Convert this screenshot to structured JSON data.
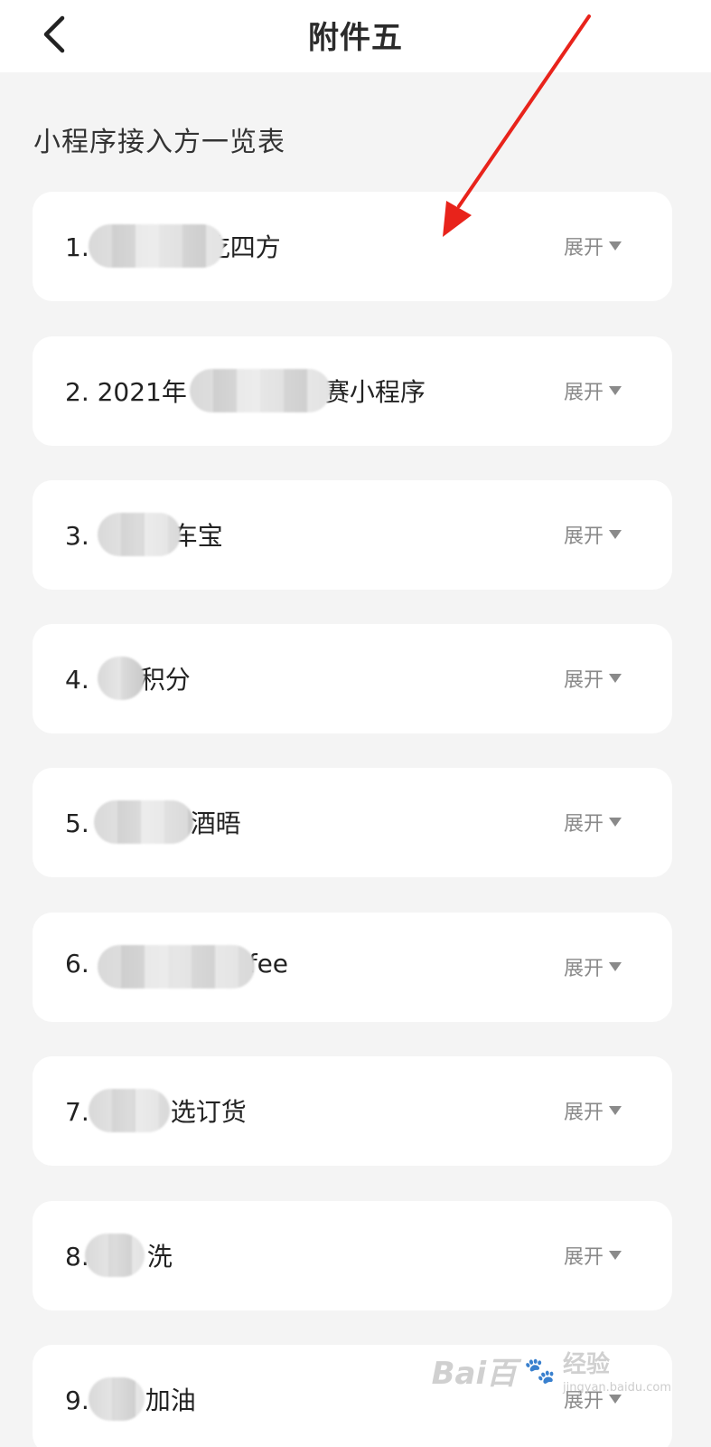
{
  "header": {
    "title": "附件五"
  },
  "section": {
    "title": "小程序接入方一览表"
  },
  "items": [
    {
      "label": "1.",
      "tail": "吃四方",
      "expand": "展开"
    },
    {
      "label": "2. 2021年",
      "tail": "赛小程序",
      "expand": "展开"
    },
    {
      "label": "3.",
      "tail": "车宝",
      "expand": "展开"
    },
    {
      "label": "4.",
      "tail": "积分",
      "expand": "展开"
    },
    {
      "label": "5.",
      "tail": "酒晤",
      "expand": "展开"
    },
    {
      "label": "6.",
      "tail": "fee",
      "expand": "展开"
    },
    {
      "label": "7.",
      "tail": "选订货",
      "expand": "展开"
    },
    {
      "label": "8.",
      "tail": "洗",
      "expand": "展开"
    },
    {
      "label": "9.",
      "tail": "加油",
      "expand": "展开"
    }
  ],
  "watermark": {
    "brand": "Bai百",
    "sub": "jingyan.baidu.com",
    "suffix": "经验"
  },
  "colors": {
    "background": "#f4f4f4",
    "card": "#ffffff",
    "annotation_arrow": "#e8231b",
    "expand_text": "#8a8a8a"
  }
}
